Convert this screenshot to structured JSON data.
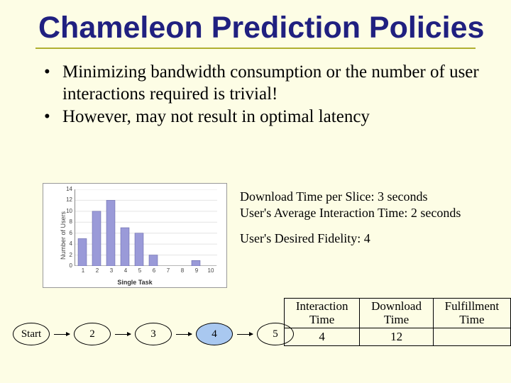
{
  "title": "Chameleon Prediction Policies",
  "bullets": [
    "Minimizing bandwidth consumption or the number of user interactions required is trivial!",
    "However, may not result in optimal latency"
  ],
  "chart_data": {
    "type": "bar",
    "categories": [
      "1",
      "2",
      "3",
      "4",
      "5",
      "6",
      "7",
      "8",
      "9",
      "10"
    ],
    "values": [
      5,
      10,
      12,
      7,
      6,
      2,
      0,
      0,
      1,
      0
    ],
    "ylabel": "Number of Users",
    "xlabel": "Single Task",
    "ylim": [
      0,
      14
    ],
    "yticks": [
      0,
      2,
      4,
      6,
      8,
      10,
      12,
      14
    ]
  },
  "params": {
    "download_time": "Download Time per Slice: 3 seconds",
    "interaction_time": "User's Average Interaction Time: 2 seconds",
    "desired_fidelity": "User's Desired Fidelity: 4"
  },
  "table": {
    "headers": [
      "Interaction Time",
      "Download Time",
      "Fulfillment Time"
    ],
    "row": [
      "4",
      "12",
      ""
    ]
  },
  "flow": {
    "nodes": [
      "Start",
      "2",
      "3",
      "4",
      "5"
    ],
    "highlight_index": 3
  }
}
